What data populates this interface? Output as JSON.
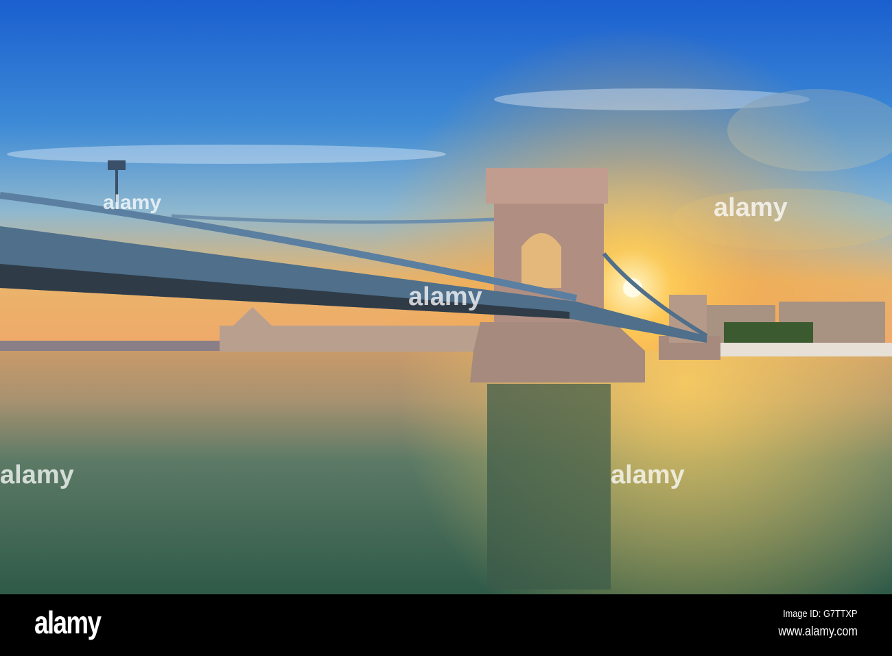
{
  "photo": {
    "subject": "Chain Bridge over the Danube at sunrise, Budapest",
    "colors": {
      "sky_top": "#1f6fd0",
      "sky_mid": "#6fa8d8",
      "horizon": "#f3b65a",
      "sun": "#fff4c0",
      "water": "#4f7058",
      "bridge": "#4d6e8a",
      "stone": "#a88a7c"
    }
  },
  "watermark": {
    "text": "alamy"
  },
  "footer": {
    "logo": "alamy",
    "image_id": "Image ID: G7TTXP",
    "url": "www.alamy.com"
  }
}
